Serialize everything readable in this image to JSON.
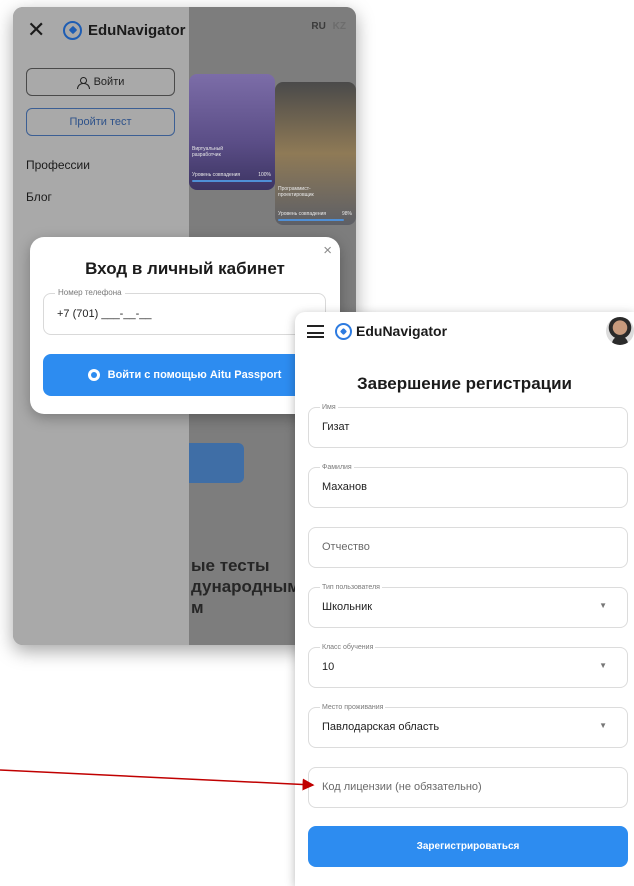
{
  "left_screen": {
    "menu": {
      "logo_text": "EduNavigator",
      "lang_ru": "RU",
      "lang_kz": "KZ",
      "login_label": "Войти",
      "test_label": "Пройти тест",
      "links": [
        "Профессии",
        "Блог"
      ]
    },
    "cards": [
      {
        "title_line1": "Виртуальный",
        "title_line2": "разработчик",
        "meta": "Уровень совпадения",
        "percent": "100%"
      },
      {
        "title_line1": "Программист-",
        "title_line2": "проектировщик",
        "meta": "Уровень совпадения",
        "percent": "98%"
      }
    ],
    "hero_text": "ые тесты\nдународным\nм",
    "modal": {
      "title": "Вход в личный кабинет",
      "close_glyph": "×",
      "phone_label": "Номер телефона",
      "phone_value": "+7 (701) ___-__-__",
      "aitu_button": "Войти с помощью Aitu Passport"
    }
  },
  "right_screen": {
    "header": {
      "logo_text": "EduNavigator"
    },
    "title": "Завершение регистрации",
    "fields": {
      "first_name": {
        "label": "Имя",
        "value": "Гизат"
      },
      "last_name": {
        "label": "Фамилия",
        "value": "Маханов"
      },
      "patronymic": {
        "placeholder": "Отчество"
      },
      "user_type": {
        "label": "Тип пользователя",
        "value": "Школьник"
      },
      "grade": {
        "label": "Класс обучения",
        "value": "10"
      },
      "residence": {
        "label": "Место проживания",
        "value": "Павлодарская область"
      },
      "license": {
        "placeholder": "Код лицензии (не обязательно)"
      }
    },
    "submit_label": "Зарегистрироваться"
  },
  "colors": {
    "accent": "#2d8cf0",
    "annotation_arrow": "#c00000",
    "overlay_dim": "#8f8f8f"
  },
  "icons": [
    "close-icon",
    "compass-logo-icon",
    "user-icon",
    "hamburger-icon",
    "avatar",
    "chevron-down-icon",
    "aitu-icon"
  ]
}
